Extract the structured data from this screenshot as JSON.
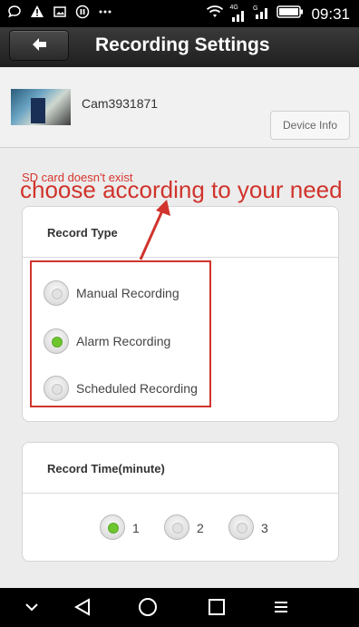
{
  "status_bar": {
    "time": "09:31",
    "network_label": "4G"
  },
  "header": {
    "title": "Recording Settings"
  },
  "device": {
    "name": "Cam3931871",
    "info_button_label": "Device Info"
  },
  "sd_message": "SD card doesn't exist",
  "annotation": "choose according to your need",
  "record_type": {
    "title": "Record Type",
    "options": [
      {
        "label": "Manual Recording",
        "selected": false
      },
      {
        "label": "Alarm Recording",
        "selected": true
      },
      {
        "label": "Scheduled Recording",
        "selected": false
      }
    ]
  },
  "record_time": {
    "title": "Record Time(minute)",
    "options": [
      {
        "label": "1",
        "selected": true
      },
      {
        "label": "2",
        "selected": false
      },
      {
        "label": "3",
        "selected": false
      }
    ]
  },
  "colors": {
    "accent_red": "#d0342c",
    "selected_green": "#6ec62e",
    "appbar": "#2a2a2a"
  }
}
